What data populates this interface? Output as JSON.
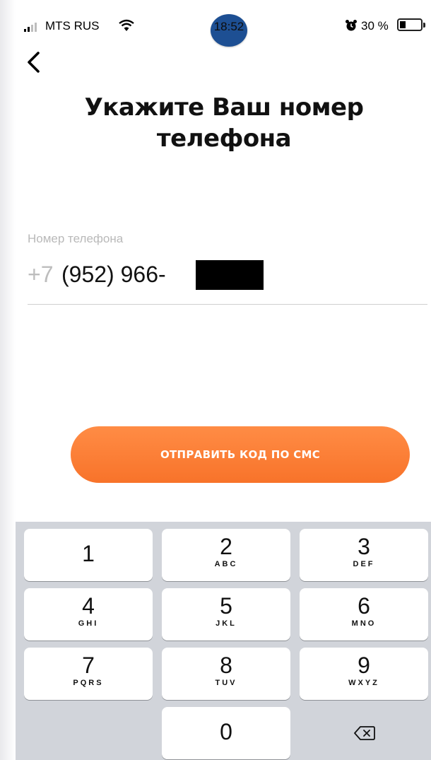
{
  "status_bar": {
    "carrier": "MTS RUS",
    "time": "18:52",
    "battery_percent": "30 %",
    "battery_level": 0.3,
    "icons": [
      "signal-icon",
      "wifi-icon",
      "alarm-icon",
      "battery-icon"
    ]
  },
  "nav": {
    "back_icon": "chevron-left-icon"
  },
  "page": {
    "title": "Укажите Ваш номер телефона"
  },
  "phone_field": {
    "label": "Номер телефона",
    "prefix": "+7",
    "value": "(952) 966-"
  },
  "actions": {
    "send_sms": "ОТПРАВИТЬ КОД ПО СМС"
  },
  "keypad": {
    "keys": [
      {
        "digit": "1",
        "letters": ""
      },
      {
        "digit": "2",
        "letters": "ABC"
      },
      {
        "digit": "3",
        "letters": "DEF"
      },
      {
        "digit": "4",
        "letters": "GHI"
      },
      {
        "digit": "5",
        "letters": "JKL"
      },
      {
        "digit": "6",
        "letters": "MNO"
      },
      {
        "digit": "7",
        "letters": "PQRS"
      },
      {
        "digit": "8",
        "letters": "TUV"
      },
      {
        "digit": "9",
        "letters": "WXYZ"
      },
      {
        "digit": "0",
        "letters": ""
      }
    ],
    "delete_icon": "backspace-icon"
  },
  "colors": {
    "accent": "#f8732a",
    "time_bubble": "#1d4f93",
    "keyboard_bg": "#d1d4da"
  }
}
